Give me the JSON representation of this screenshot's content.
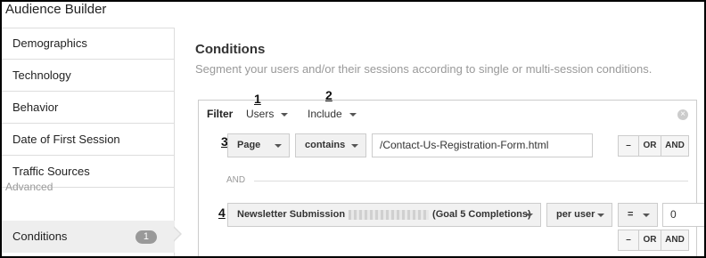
{
  "app": {
    "title": "Audience Builder"
  },
  "sidebar": {
    "items": [
      {
        "label": "Demographics"
      },
      {
        "label": "Technology"
      },
      {
        "label": "Behavior"
      },
      {
        "label": "Date of First Session"
      },
      {
        "label": "Traffic Sources"
      }
    ],
    "section_label": "Advanced",
    "active_item": {
      "label": "Conditions",
      "badge": "1"
    }
  },
  "main": {
    "title": "Conditions",
    "description": "Segment your users and/or their sessions according to single or multi-session conditions."
  },
  "filter": {
    "label": "Filter",
    "scope": "Users",
    "mode": "Include",
    "annotations": [
      "1",
      "2",
      "3",
      "4"
    ],
    "close_icon": "close-circle-icon",
    "row1": {
      "dimension": "Page",
      "operator": "contains",
      "value": "/Contact-Us-Registration-Form.html"
    },
    "separator": "AND",
    "row2": {
      "metric": "Newsletter Submission",
      "metric_suffix": "(Goal 5 Completions)",
      "per": "per user",
      "comparator": "=",
      "value": "0"
    },
    "buttons": {
      "remove": "–",
      "or": "OR",
      "and": "AND"
    }
  }
}
